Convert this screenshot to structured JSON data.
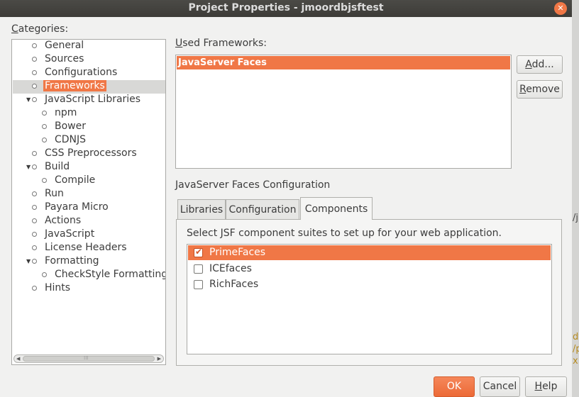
{
  "window": {
    "title": "Project Properties - jmoordbjsftest",
    "close_glyph": "✕"
  },
  "categories": {
    "label": "Categories:",
    "items": [
      {
        "label": "General",
        "level": 0,
        "expander": "",
        "selected": false
      },
      {
        "label": "Sources",
        "level": 0,
        "expander": "",
        "selected": false
      },
      {
        "label": "Configurations",
        "level": 0,
        "expander": "",
        "selected": false
      },
      {
        "label": "Frameworks",
        "level": 0,
        "expander": "",
        "selected": true
      },
      {
        "label": "JavaScript Libraries",
        "level": 0,
        "expander": "▼",
        "selected": false
      },
      {
        "label": "npm",
        "level": 1,
        "expander": "",
        "selected": false
      },
      {
        "label": "Bower",
        "level": 1,
        "expander": "",
        "selected": false
      },
      {
        "label": "CDNJS",
        "level": 1,
        "expander": "",
        "selected": false
      },
      {
        "label": "CSS Preprocessors",
        "level": 0,
        "expander": "",
        "selected": false
      },
      {
        "label": "Build",
        "level": 0,
        "expander": "▼",
        "selected": false
      },
      {
        "label": "Compile",
        "level": 1,
        "expander": "",
        "selected": false
      },
      {
        "label": "Run",
        "level": 0,
        "expander": "",
        "selected": false
      },
      {
        "label": "Payara Micro",
        "level": 0,
        "expander": "",
        "selected": false
      },
      {
        "label": "Actions",
        "level": 0,
        "expander": "",
        "selected": false
      },
      {
        "label": "JavaScript",
        "level": 0,
        "expander": "",
        "selected": false
      },
      {
        "label": "License Headers",
        "level": 0,
        "expander": "",
        "selected": false
      },
      {
        "label": "Formatting",
        "level": 0,
        "expander": "▼",
        "selected": false
      },
      {
        "label": "CheckStyle Formatting",
        "level": 1,
        "expander": "",
        "selected": false
      },
      {
        "label": "Hints",
        "level": 0,
        "expander": "",
        "selected": false
      }
    ]
  },
  "frameworks": {
    "label": "Used Frameworks:",
    "items": [
      "JavaServer Faces"
    ],
    "add_label": "Add...",
    "remove_label": "Remove"
  },
  "jsf_config": {
    "label": "JavaServer Faces Configuration",
    "tabs": [
      {
        "label": "Libraries",
        "active": false
      },
      {
        "label": "Configuration",
        "active": false
      },
      {
        "label": "Components",
        "active": true
      }
    ],
    "instruction": "Select JSF component suites to set up for your web application.",
    "components": [
      {
        "label": "PrimeFaces",
        "checked": true,
        "selected": true
      },
      {
        "label": "ICEfaces",
        "checked": false,
        "selected": false
      },
      {
        "label": "RichFaces",
        "checked": false,
        "selected": false
      }
    ]
  },
  "footer": {
    "ok_label": "OK",
    "cancel_label": "Cancel",
    "help_label": "Help"
  },
  "background": {
    "snippets": [
      "/j",
      "dy",
      "/p",
      "x"
    ]
  },
  "colors": {
    "accent": "#f07746",
    "dialog_bg": "#f1f1f0",
    "titlebar_bg": "#3d3c38"
  }
}
